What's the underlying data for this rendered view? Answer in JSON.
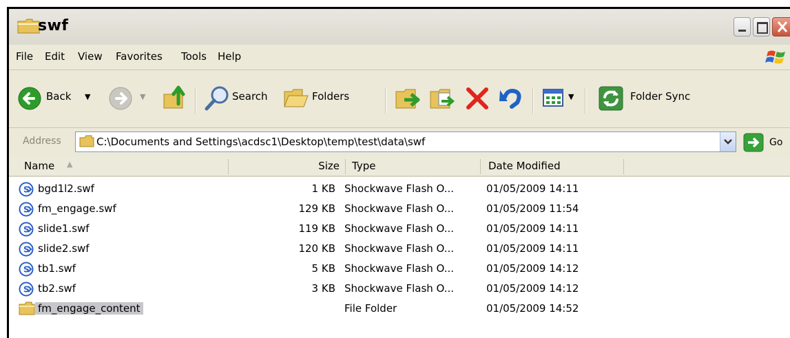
{
  "window": {
    "title": "swf"
  },
  "menu": [
    "File",
    "Edit",
    "View",
    "Favorites",
    "Tools",
    "Help"
  ],
  "toolbar": {
    "back": "Back",
    "search": "Search",
    "folders": "Folders",
    "folder_sync": "Folder Sync"
  },
  "address": {
    "label": "Address",
    "path": "C:\\Documents and Settings\\acdsc1\\Desktop\\temp\\test\\data\\swf",
    "go": "Go"
  },
  "columns": {
    "name": "Name",
    "size": "Size",
    "type": "Type",
    "date": "Date Modified"
  },
  "files": [
    {
      "name": "bgd1l2.swf",
      "size": "1 KB",
      "type": "Shockwave Flash O...",
      "date": "01/05/2009 14:11",
      "icon": "swf-icon"
    },
    {
      "name": "fm_engage.swf",
      "size": "129 KB",
      "type": "Shockwave Flash O...",
      "date": "01/05/2009 11:54",
      "icon": "swf-icon"
    },
    {
      "name": "slide1.swf",
      "size": "119 KB",
      "type": "Shockwave Flash O...",
      "date": "01/05/2009 14:11",
      "icon": "swf-icon"
    },
    {
      "name": "slide2.swf",
      "size": "120 KB",
      "type": "Shockwave Flash O...",
      "date": "01/05/2009 14:11",
      "icon": "swf-icon"
    },
    {
      "name": "tb1.swf",
      "size": "5 KB",
      "type": "Shockwave Flash O...",
      "date": "01/05/2009 14:12",
      "icon": "swf-icon"
    },
    {
      "name": "tb2.swf",
      "size": "3 KB",
      "type": "Shockwave Flash O...",
      "date": "01/05/2009 14:12",
      "icon": "swf-icon"
    },
    {
      "name": "fm_engage_content",
      "size": "",
      "type": "File Folder",
      "date": "01/05/2009 14:52",
      "icon": "folder-icon",
      "selected": true
    }
  ],
  "colors": {
    "swf_blue": "#2a5fc4",
    "folder_yellow": "#e8c35a",
    "selection": "#c7c6cb",
    "green_nav": "#2e9c2a"
  }
}
